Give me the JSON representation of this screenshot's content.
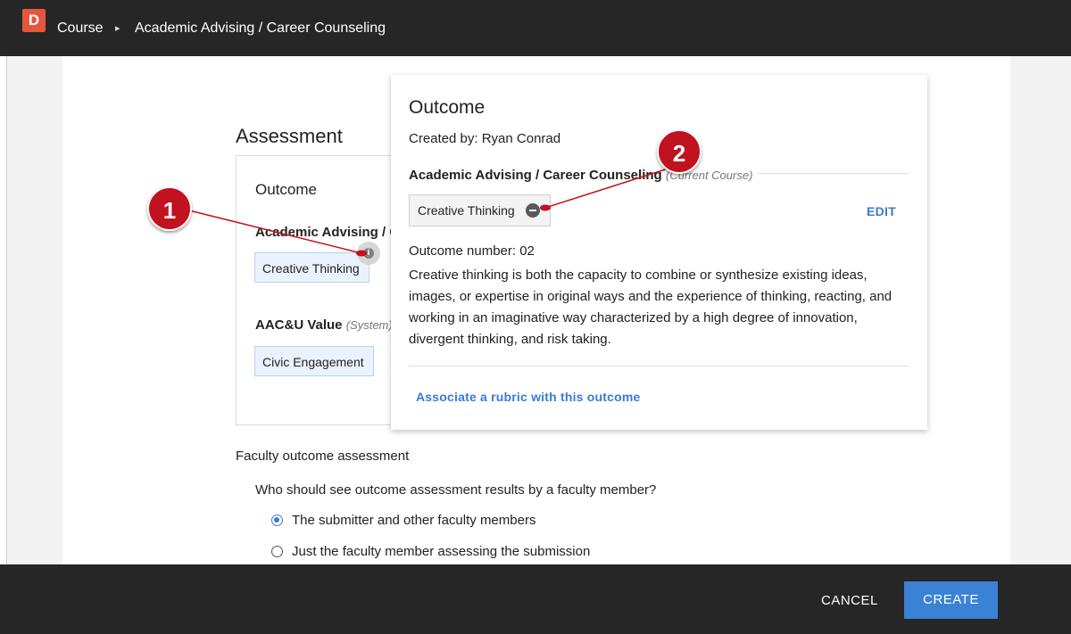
{
  "topbar": {
    "logo_letter": "D",
    "breadcrumb": [
      "Course",
      "Academic Advising / Career Counseling"
    ],
    "separator": "▸"
  },
  "assessment": {
    "title": "Assessment",
    "card": {
      "heading": "Outcome",
      "group": "Academic Advising / Career Counseling",
      "outcome_chip": "Creative Thinking",
      "info_glyph": "i",
      "aacu_label": "AAC&U Value",
      "aacu_tag": "(System)",
      "aacu_chip": "Civic Engagement"
    }
  },
  "popover": {
    "title": "Outcome",
    "created_by": "Created by: Ryan Conrad",
    "group": "Academic Advising / Career Counseling",
    "group_tag": "(Current Course)",
    "outcome_chip": "Creative Thinking",
    "edit": "EDIT",
    "number": "Outcome number: 02",
    "description": "Creative thinking is both the capacity to combine or synthesize existing ideas, images, or expertise in original ways and the experience of thinking, reacting, and working in an imaginative way characterized by a high degree of innovation, divergent thinking, and risk taking.",
    "rubric_link": "Associate a rubric with this outcome"
  },
  "faculty": {
    "title": "Faculty outcome assessment",
    "question": "Who should see outcome assessment results by a faculty member?",
    "options": [
      {
        "label": "The submitter and other faculty members",
        "selected": true
      },
      {
        "label": "Just the faculty member assessing the submission",
        "selected": false
      }
    ]
  },
  "footer": {
    "cancel": "CANCEL",
    "create": "CREATE"
  },
  "callouts": [
    "1",
    "2"
  ],
  "colors": {
    "accent": "#3b82d6",
    "callout": "#c1121f",
    "logo": "#e4573d",
    "bar": "#262626"
  }
}
